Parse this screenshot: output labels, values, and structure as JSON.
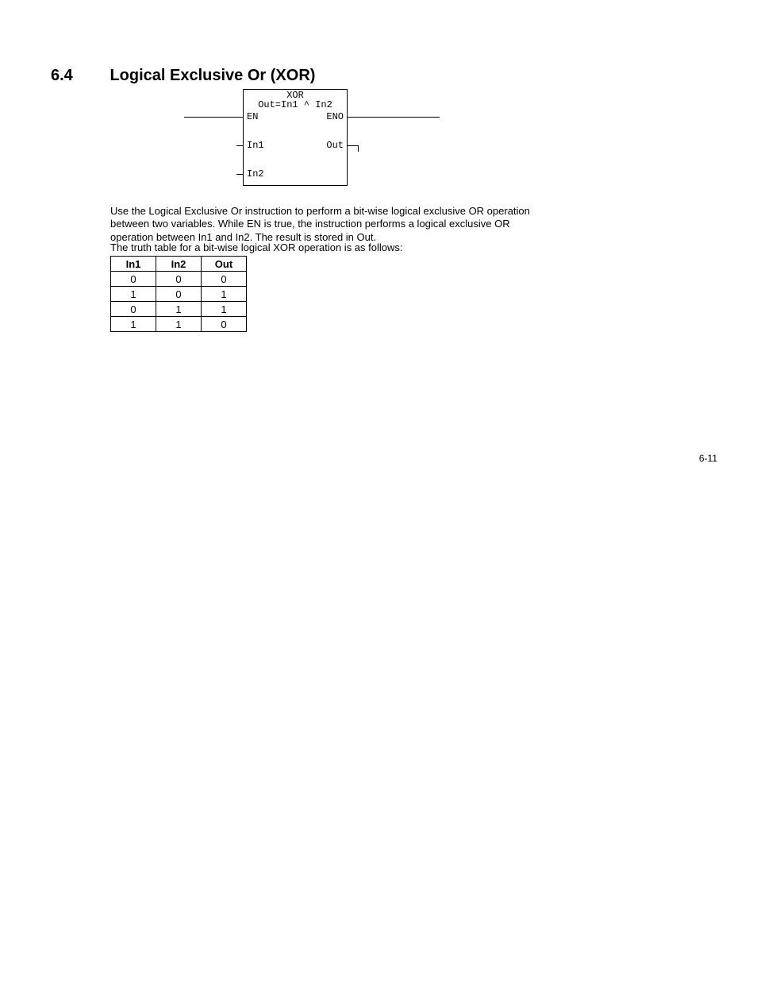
{
  "heading": {
    "number": "6.4",
    "title": "Logical Exclusive Or (XOR)"
  },
  "block": {
    "name": "XOR",
    "equation": "Out=In1 ^ In2",
    "en": "EN",
    "eno": "ENO",
    "in1": "In1",
    "in2": "In2",
    "out": "Out"
  },
  "paragraphs": {
    "p1": "Use the Logical Exclusive Or instruction to perform a bit-wise logical exclusive OR operation between two variables. While EN is true, the instruction performs a logical exclusive OR operation between In1 and In2. The result is stored in Out.",
    "p2": "The truth table for a bit-wise logical XOR operation is as follows:"
  },
  "chart_data": {
    "type": "table",
    "title": "XOR truth table",
    "columns": [
      "In1",
      "In2",
      "Out"
    ],
    "rows": [
      [
        0,
        0,
        0
      ],
      [
        1,
        0,
        1
      ],
      [
        0,
        1,
        1
      ],
      [
        1,
        1,
        0
      ]
    ]
  },
  "page_number": "6-11"
}
